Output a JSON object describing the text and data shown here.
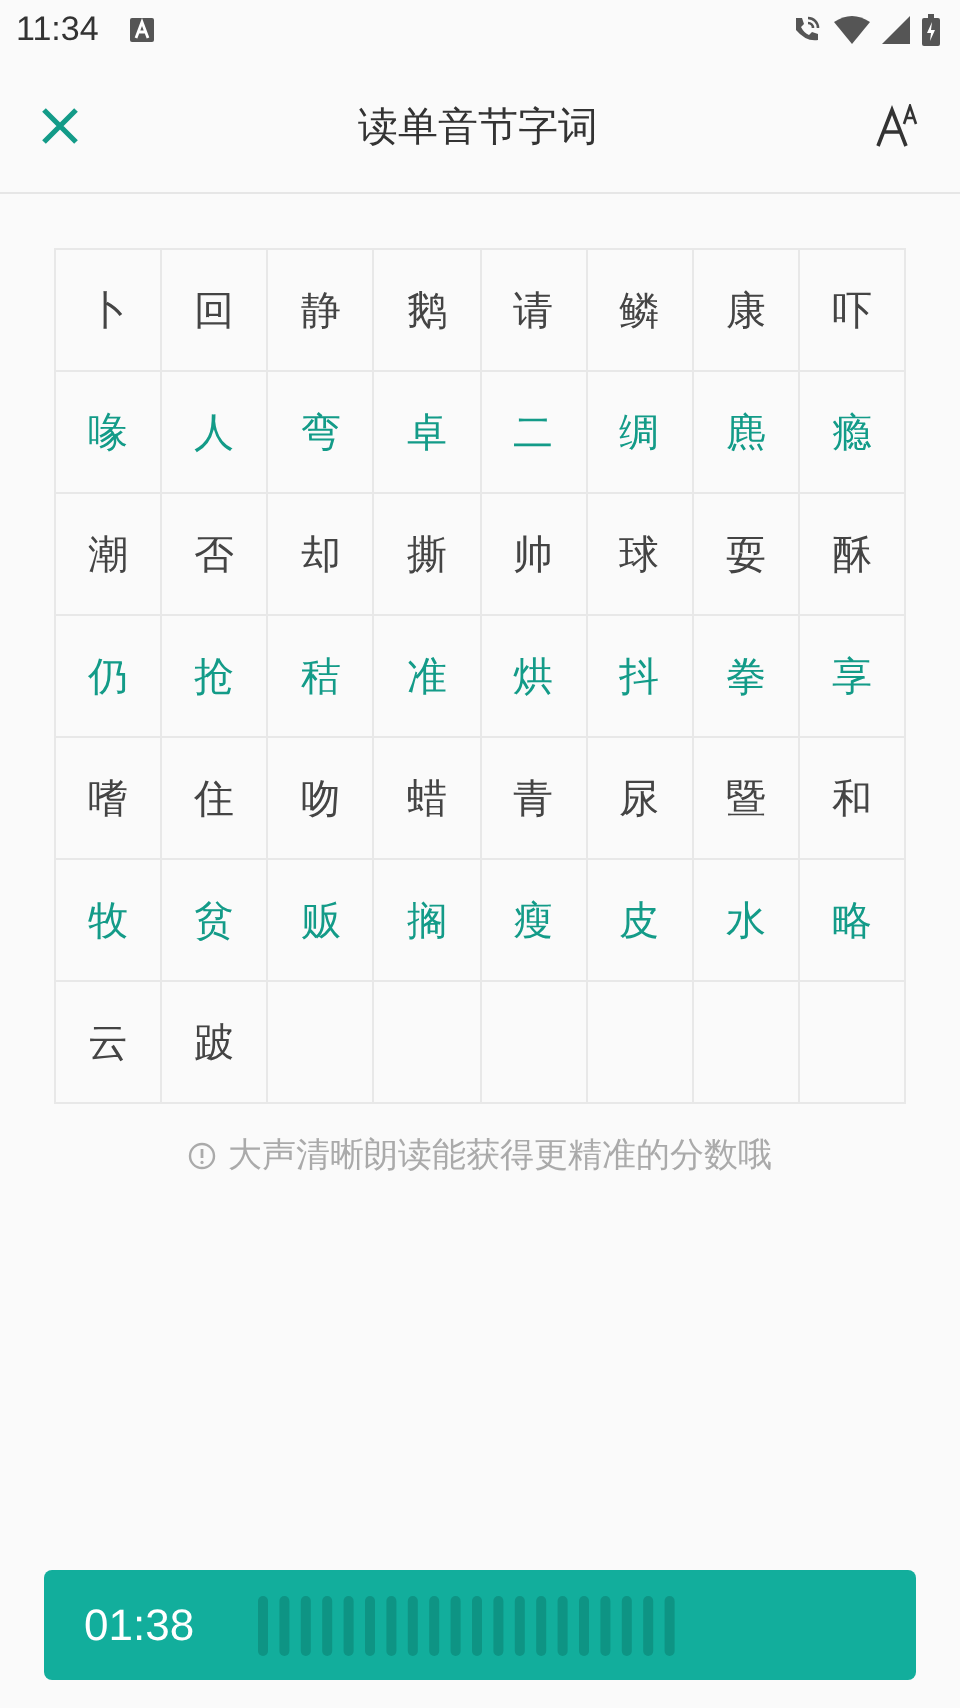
{
  "status_bar": {
    "time": "11:34"
  },
  "header": {
    "title": "读单音节字词"
  },
  "grid": {
    "rows": [
      {
        "accent": false,
        "chars": [
          "卜",
          "回",
          "静",
          "鹅",
          "请",
          "鳞",
          "康",
          "吓"
        ]
      },
      {
        "accent": true,
        "chars": [
          "喙",
          "人",
          "弯",
          "卓",
          "二",
          "绸",
          "麃",
          "瘾"
        ]
      },
      {
        "accent": false,
        "chars": [
          "潮",
          "否",
          "却",
          "撕",
          "帅",
          "球",
          "耍",
          "酥"
        ]
      },
      {
        "accent": true,
        "chars": [
          "仍",
          "抢",
          "秸",
          "准",
          "烘",
          "抖",
          "拳",
          "享"
        ]
      },
      {
        "accent": false,
        "chars": [
          "嗜",
          "住",
          "吻",
          "蜡",
          "青",
          "尿",
          "暨",
          "和"
        ]
      },
      {
        "accent": true,
        "chars": [
          "牧",
          "贫",
          "贩",
          "搁",
          "瘦",
          "皮",
          "水",
          "略"
        ]
      },
      {
        "accent": false,
        "chars": [
          "云",
          "跛"
        ]
      }
    ]
  },
  "hint": "大声清晰朗读能获得更精准的分数哦",
  "recorder": {
    "time": "01:38"
  }
}
